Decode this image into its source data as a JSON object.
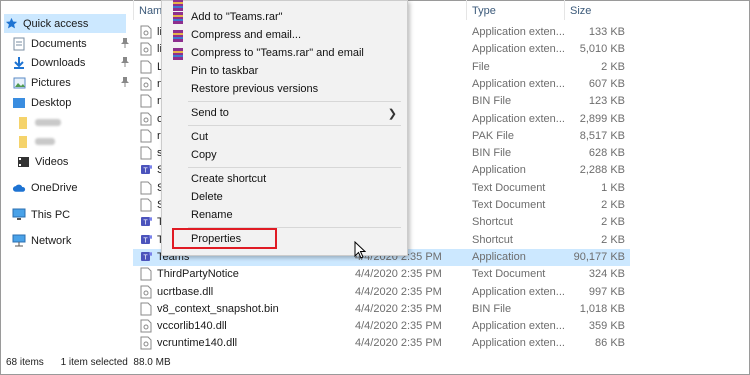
{
  "nav": {
    "items": [
      {
        "label": "Quick access",
        "icon": "star-icon"
      },
      {
        "label": "Documents",
        "icon": "documents-icon",
        "pinned": true
      },
      {
        "label": "Downloads",
        "icon": "downloads-icon",
        "pinned": true
      },
      {
        "label": "Pictures",
        "icon": "pictures-icon",
        "pinned": true
      },
      {
        "label": "Desktop",
        "icon": "desktop-icon"
      },
      {
        "label": "",
        "icon": "folder-icon"
      },
      {
        "label": "",
        "icon": "folder-icon"
      },
      {
        "label": "Videos",
        "icon": "videos-icon"
      },
      {
        "label": "OneDrive",
        "icon": "cloud-icon"
      },
      {
        "label": "This PC",
        "icon": "pc-icon"
      },
      {
        "label": "Network",
        "icon": "network-icon"
      }
    ]
  },
  "columns": {
    "name": "Name",
    "type": "Type",
    "size": "Size"
  },
  "files": [
    {
      "name": "li",
      "date": "5 PM",
      "type": "Application exten...",
      "size": "133 KB",
      "icon": "dll-file-icon"
    },
    {
      "name": "li",
      "date": "5 PM",
      "type": "Application exten...",
      "size": "5,010 KB",
      "icon": "dll-file-icon"
    },
    {
      "name": "L",
      "date": "5 PM",
      "type": "File",
      "size": "2 KB",
      "icon": "file-icon"
    },
    {
      "name": "n",
      "date": "5 PM",
      "type": "Application exten...",
      "size": "607 KB",
      "icon": "dll-file-icon"
    },
    {
      "name": "n",
      "date": "5 PM",
      "type": "BIN File",
      "size": "123 KB",
      "icon": "file-icon"
    },
    {
      "name": "o",
      "date": "5 PM",
      "type": "Application exten...",
      "size": "2,899 KB",
      "icon": "dll-file-icon"
    },
    {
      "name": "r",
      "date": "5 PM",
      "type": "PAK File",
      "size": "8,517 KB",
      "icon": "file-icon"
    },
    {
      "name": "s",
      "date": "5 PM",
      "type": "BIN File",
      "size": "628 KB",
      "icon": "file-icon"
    },
    {
      "name": "S",
      "date": "5 PM",
      "type": "Application",
      "size": "2,288 KB",
      "icon": "teams-icon"
    },
    {
      "name": "S",
      "date": "5 PM",
      "type": "Text Document",
      "size": "1 KB",
      "icon": "file-icon"
    },
    {
      "name": "S",
      "date": "5 PM",
      "type": "Text Document",
      "size": "2 KB",
      "icon": "file-icon"
    },
    {
      "name": "T",
      "date": "5 PM",
      "type": "Shortcut",
      "size": "2 KB",
      "icon": "teams-icon"
    },
    {
      "name": "T",
      "date": "5 PM",
      "type": "Shortcut",
      "size": "2 KB",
      "icon": "teams-icon"
    },
    {
      "name": "Teams",
      "date": "4/4/2020 2:35 PM",
      "type": "Application",
      "size": "90,177 KB",
      "icon": "teams-icon",
      "selected": true
    },
    {
      "name": "ThirdPartyNotice",
      "date": "4/4/2020 2:35 PM",
      "type": "Text Document",
      "size": "324 KB",
      "icon": "file-icon"
    },
    {
      "name": "ucrtbase.dll",
      "date": "4/4/2020 2:35 PM",
      "type": "Application exten...",
      "size": "997 KB",
      "icon": "dll-file-icon"
    },
    {
      "name": "v8_context_snapshot.bin",
      "date": "4/4/2020 2:35 PM",
      "type": "BIN File",
      "size": "1,018 KB",
      "icon": "file-icon"
    },
    {
      "name": "vccorlib140.dll",
      "date": "4/4/2020 2:35 PM",
      "type": "Application exten...",
      "size": "359 KB",
      "icon": "dll-file-icon"
    },
    {
      "name": "vcruntime140.dll",
      "date": "4/4/2020 2:35 PM",
      "type": "Application exten...",
      "size": "86 KB",
      "icon": "dll-file-icon"
    }
  ],
  "status": {
    "count": "68 items",
    "selection": "1 item selected  88.0 MB"
  },
  "context_menu": {
    "items": [
      {
        "label": "Add to \"Teams.rar\"",
        "icon": "winrar-icon"
      },
      {
        "label": "Compress and email...",
        "icon": "winrar-icon"
      },
      {
        "label": "Compress to \"Teams.rar\" and email",
        "icon": "winrar-icon"
      },
      {
        "label": "Pin to taskbar"
      },
      {
        "label": "Restore previous versions"
      },
      {
        "label": "Send to",
        "submenu": true
      },
      {
        "label": "Cut"
      },
      {
        "label": "Copy"
      },
      {
        "label": "Create shortcut"
      },
      {
        "label": "Delete"
      },
      {
        "label": "Rename"
      },
      {
        "label": "Properties",
        "highlighted": true
      }
    ]
  },
  "colors": {
    "selection": "#cce8ff",
    "highlight_box": "#e01b24",
    "menu_bg": "#f2f2f2"
  }
}
